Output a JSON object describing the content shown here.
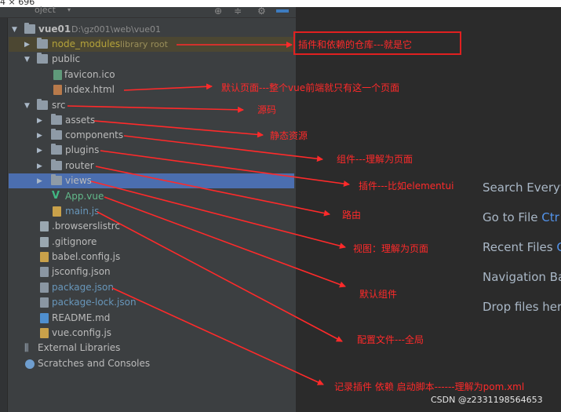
{
  "screen": {
    "dimension_label": "4 × 696"
  },
  "project_panel": {
    "title": "oject",
    "caret": "▾"
  },
  "tree": {
    "root": {
      "name": "vue01",
      "path": "D:\\gz001\\web\\vue01"
    },
    "node_modules": {
      "name": "node_modules",
      "suffix": "library root"
    },
    "public": "public",
    "favicon": "favicon.ico",
    "index": "index.html",
    "src": "src",
    "assets": "assets",
    "components": "components",
    "plugins": "plugins",
    "router": "router",
    "views": "views",
    "app_vue": "App.vue",
    "main_js": "main.js",
    "browserslistrc": ".browserslistrc",
    "gitignore": ".gitignore",
    "babel_config": "babel.config.js",
    "jsconfig": "jsconfig.json",
    "package_json": "package.json",
    "package_lock": "package-lock.json",
    "readme": "README.md",
    "vue_config": "vue.config.js",
    "external_libraries": "External Libraries",
    "scratches": "Scratches and Consoles"
  },
  "welcome": {
    "search_everywhere": "Search Everyw",
    "goto_file": "Go to File",
    "goto_file_shortcut": "Ctr",
    "recent_files": "Recent Files",
    "recent_files_shortcut": "C",
    "navigation_bar": "Navigation Ba",
    "drop_files": "Drop files her"
  },
  "annotations": {
    "node_modules": "插件和依赖的仓库---就是它",
    "index_html": "默认页面---整个vue前端就只有这一个页面",
    "src": "源码",
    "assets": "静态资源",
    "components": "组件---理解为页面",
    "plugins": "插件---比如elementui",
    "router": "路由",
    "views": "视图：理解为页面",
    "app_vue": "默认组件",
    "main_js": "配置文件---全局",
    "package_json": "记录插件  依赖  启动脚本------理解为pom.xml"
  },
  "watermark": "CSDN @z2331198564653"
}
